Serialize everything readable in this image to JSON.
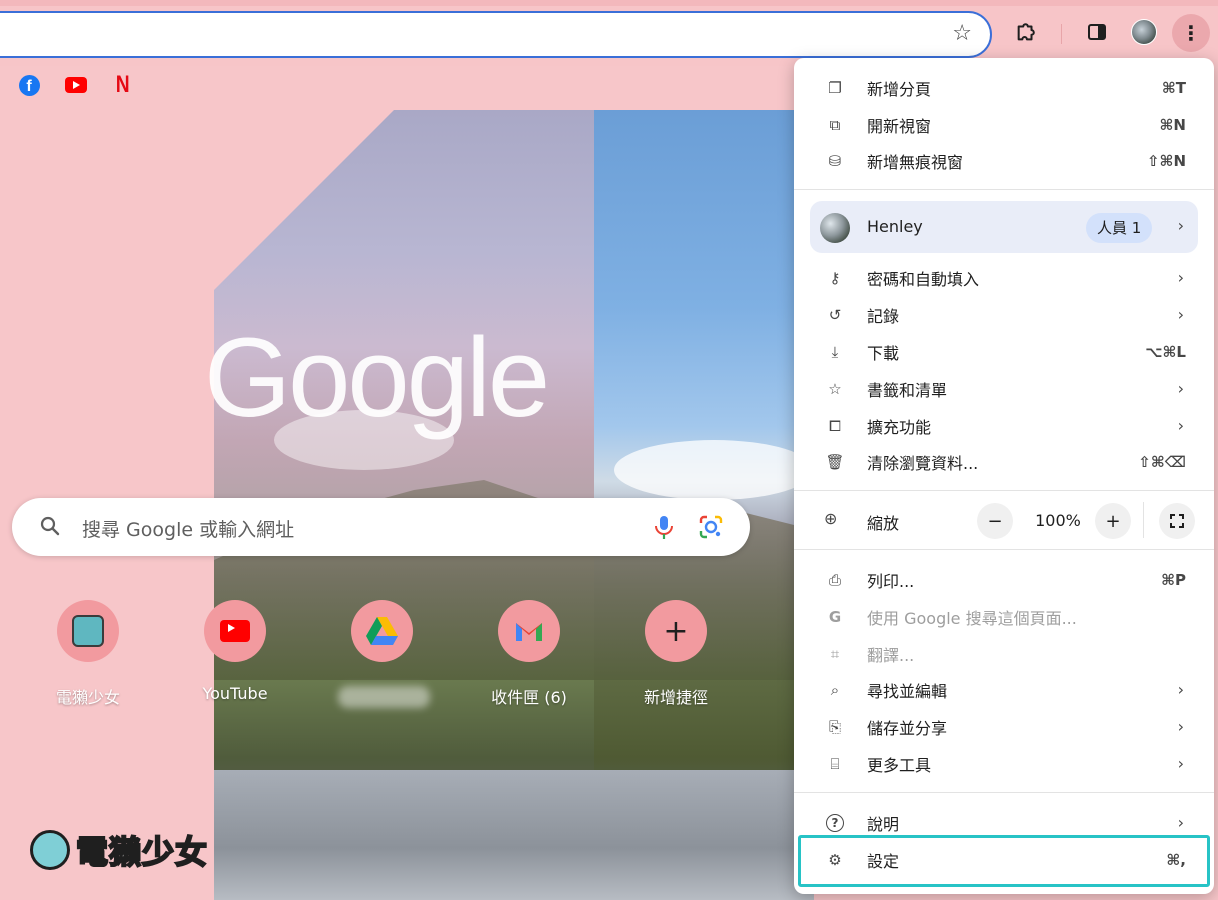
{
  "toolbar": {
    "star_icon": "star-icon",
    "extensions_icon": "puzzle-icon",
    "side_panel_icon": "side-panel-icon",
    "profile_icon": "avatar",
    "menu_icon": "kebab-menu-icon",
    "menu_glyph": "⋮"
  },
  "bookmarks": [
    {
      "name": "Facebook",
      "icon": "facebook-icon"
    },
    {
      "name": "YouTube",
      "icon": "youtube-icon"
    },
    {
      "name": "Netflix",
      "icon": "netflix-icon",
      "glyph": "N"
    }
  ],
  "ntp": {
    "logo": "Google",
    "search_placeholder": "搜尋 Google 或輸入網址",
    "shortcuts": [
      {
        "label": "電獺少女",
        "icon": "site-avatar-icon"
      },
      {
        "label": "YouTube",
        "icon": "youtube-icon"
      },
      {
        "label": "",
        "icon": "google-drive-icon",
        "blurred": true
      },
      {
        "label": "收件匣 (6)",
        "icon": "gmail-icon"
      },
      {
        "label": "新增捷徑",
        "icon": "plus-icon",
        "glyph": "+"
      }
    ],
    "watermark": "電獺少女"
  },
  "menu": {
    "group1": [
      {
        "label": "新增分頁",
        "shortcut": "⌘T",
        "icon": "new-tab-icon",
        "glyph": "❐"
      },
      {
        "label": "開新視窗",
        "shortcut": "⌘N",
        "icon": "new-window-icon",
        "glyph": "⧉"
      },
      {
        "label": "新增無痕視窗",
        "shortcut": "⇧⌘N",
        "icon": "incognito-icon",
        "glyph": "⛁"
      }
    ],
    "profile": {
      "name": "Henley",
      "badge": "人員 1",
      "chevron": "›"
    },
    "group2": [
      {
        "label": "密碼和自動填入",
        "icon": "key-icon",
        "glyph": "⚷",
        "chevron": "›"
      },
      {
        "label": "記錄",
        "icon": "history-icon",
        "glyph": "↺",
        "chevron": "›"
      },
      {
        "label": "下載",
        "shortcut": "⌥⌘L",
        "icon": "download-icon",
        "glyph": "⤓"
      },
      {
        "label": "書籤和清單",
        "icon": "bookmark-star-icon",
        "glyph": "☆",
        "chevron": "›"
      },
      {
        "label": "擴充功能",
        "icon": "extensions-icon",
        "glyph": "⧠",
        "chevron": "›"
      },
      {
        "label": "清除瀏覽資料...",
        "shortcut": "⇧⌘⌫",
        "icon": "trash-icon",
        "glyph": "🗑"
      }
    ],
    "zoom": {
      "label": "縮放",
      "minus": "−",
      "value": "100%",
      "plus": "+",
      "icon": "zoom-icon",
      "glyph": "⊕"
    },
    "group3": [
      {
        "label": "列印...",
        "shortcut": "⌘P",
        "icon": "print-icon",
        "glyph": "⎙"
      },
      {
        "label": "使用 Google 搜尋這個頁面...",
        "icon": "google-g-icon",
        "glyph": "G",
        "disabled": true
      },
      {
        "label": "翻譯...",
        "icon": "translate-icon",
        "glyph": "⌗",
        "disabled": true
      },
      {
        "label": "尋找並編輯",
        "icon": "find-icon",
        "glyph": "⌕",
        "chevron": "›"
      },
      {
        "label": "儲存並分享",
        "icon": "save-share-icon",
        "glyph": "⎘",
        "chevron": "›"
      },
      {
        "label": "更多工具",
        "icon": "toolbox-icon",
        "glyph": "⌸",
        "chevron": "›"
      }
    ],
    "group4": [
      {
        "label": "說明",
        "icon": "help-icon",
        "glyph": "?",
        "chevron": "›"
      },
      {
        "label": "設定",
        "shortcut": "⌘,",
        "icon": "settings-gear-icon",
        "glyph": "⚙"
      }
    ]
  },
  "colors": {
    "page_bg": "#f7c6c9",
    "omnibox_border": "#3b6fd8",
    "highlight": "#27c3c6",
    "shortcut_tile": "#f29a9f",
    "profile_row": "#e9edf8",
    "profile_badge": "#d3e1fb"
  }
}
